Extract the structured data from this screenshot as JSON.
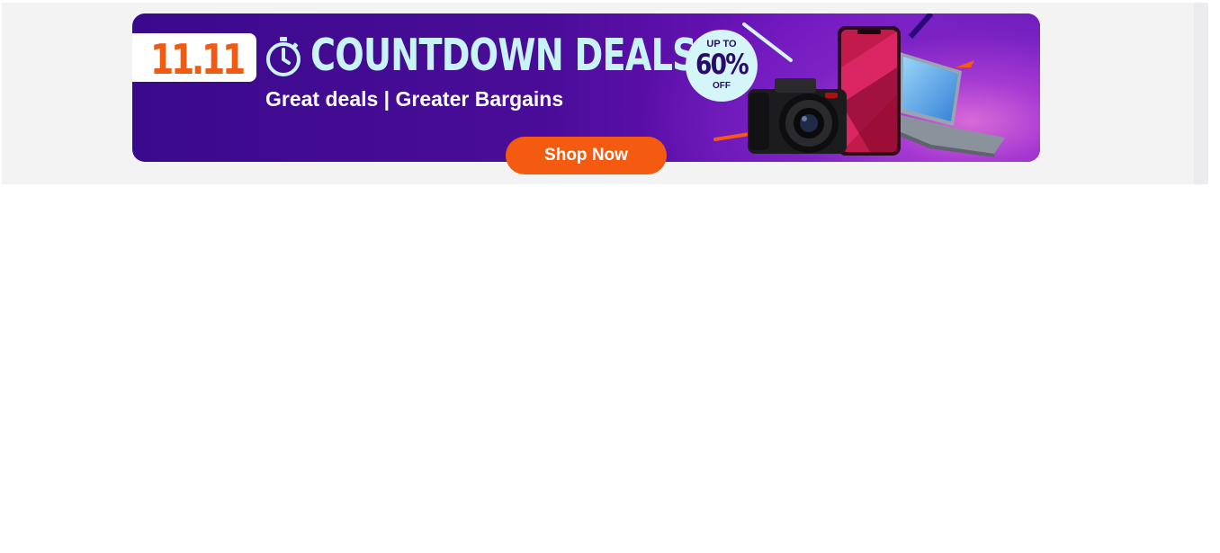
{
  "banner": {
    "event_tag": "11.11",
    "headline": "COUNTDOWN DEALS",
    "tagline": "Great deals | Greater Bargains",
    "discount": {
      "line1": "UP TO",
      "line2": "60%",
      "line3": "OFF"
    },
    "cta_label": "Shop Now",
    "icons": [
      "stopwatch-icon"
    ],
    "products": [
      "camera",
      "smartphone",
      "laptop"
    ]
  },
  "colors": {
    "banner_purple": "#4a0c98",
    "accent_orange": "#f55b10",
    "headline_cyan": "#c8f4f8",
    "page_bg": "#f3f3f4"
  }
}
